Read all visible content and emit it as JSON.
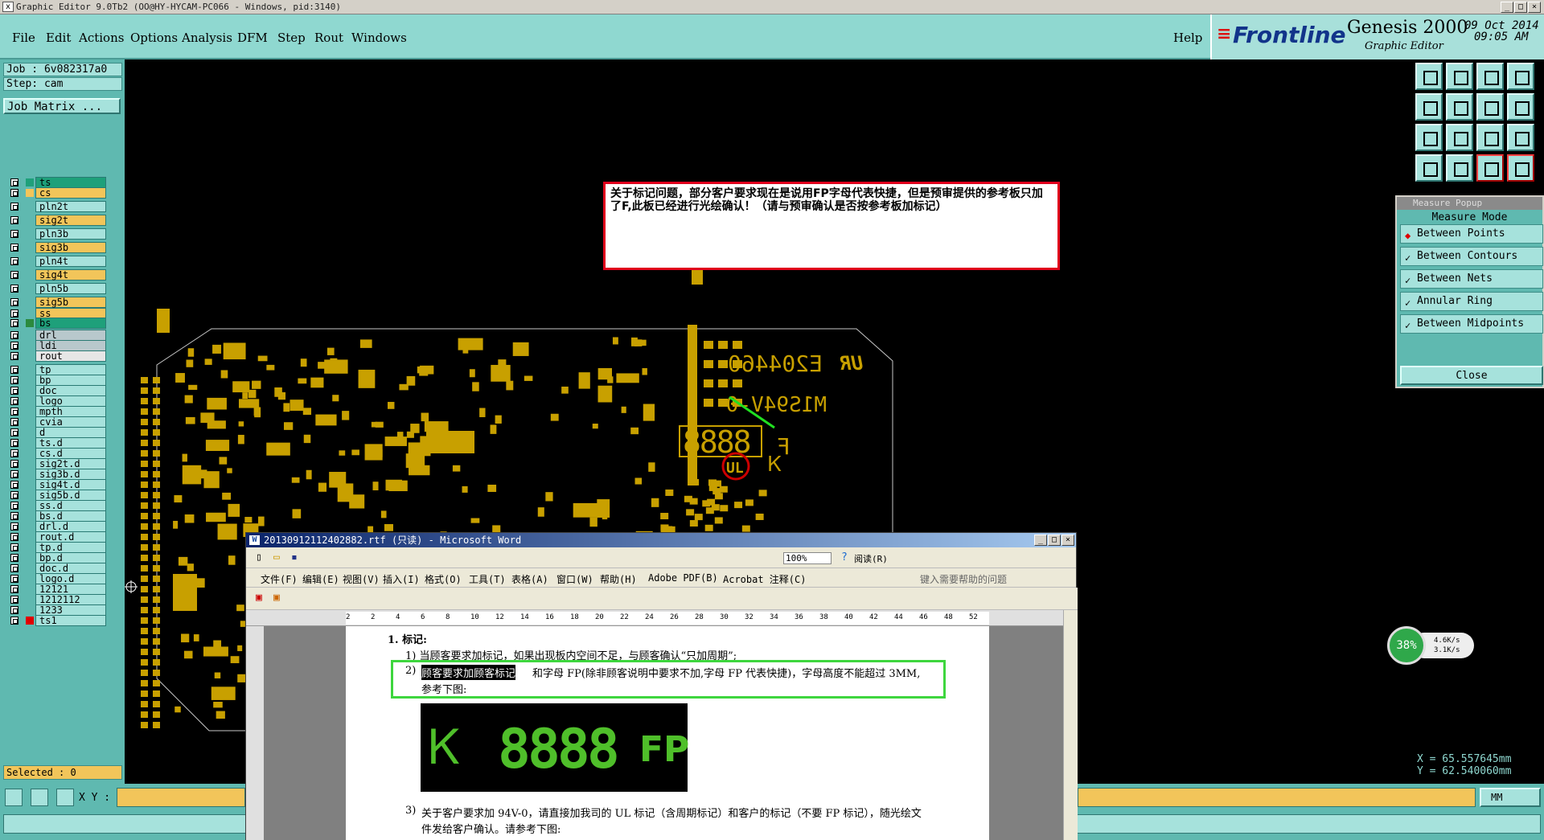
{
  "window": {
    "title": "Graphic Editor 9.0Tb2 (OO@HY-HYCAM-PC066 - Windows, pid:3140)",
    "min": "_",
    "max": "□",
    "close": "×"
  },
  "menu": [
    "File",
    "Edit",
    "Actions",
    "Options",
    "Analysis",
    "DFM",
    "Step",
    "Rout",
    "Windows"
  ],
  "help": "Help",
  "brand": {
    "logo": "Frontline",
    "product": "Genesis 2000",
    "sub": "Graphic Editor",
    "date": "09 Oct 2014",
    "time": "09:05 AM"
  },
  "job": {
    "job": "Job : 6v082317a0",
    "step": "Step: cam",
    "matrix": "Job Matrix ..."
  },
  "layers": [
    {
      "name": "ts",
      "color": "#1ea07a",
      "fill": "#1ea07a"
    },
    {
      "name": "cs",
      "color": "#f2c55a",
      "fill": "#f2c55a"
    },
    {
      "name": "pln2t",
      "color": "",
      "fill": "#a6e2dc"
    },
    {
      "name": "sig2t",
      "color": "",
      "fill": "#f2c55a"
    },
    {
      "name": "pln3b",
      "color": "",
      "fill": "#a6e2dc"
    },
    {
      "name": "sig3b",
      "color": "",
      "fill": "#f2c55a"
    },
    {
      "name": "pln4t",
      "color": "",
      "fill": "#a6e2dc"
    },
    {
      "name": "sig4t",
      "color": "",
      "fill": "#f2c55a"
    },
    {
      "name": "pln5b",
      "color": "",
      "fill": "#a6e2dc"
    },
    {
      "name": "sig5b",
      "color": "",
      "fill": "#f2c55a"
    },
    {
      "name": "ss",
      "color": "",
      "fill": "#f2c55a"
    },
    {
      "name": "bs",
      "color": "#2b8a3e",
      "fill": "#1ea07a"
    },
    {
      "name": "drl",
      "color": "",
      "fill": "#b8c8cc"
    },
    {
      "name": "ldi",
      "color": "",
      "fill": "#b8c8cc"
    },
    {
      "name": "rout",
      "color": "",
      "fill": "#e6e6e6"
    },
    {
      "name": "tp",
      "color": "",
      "fill": "#a6e2dc"
    },
    {
      "name": "bp",
      "color": "",
      "fill": "#a6e2dc"
    },
    {
      "name": "doc",
      "color": "",
      "fill": "#a6e2dc"
    },
    {
      "name": "logo",
      "color": "",
      "fill": "#a6e2dc"
    },
    {
      "name": "mpth",
      "color": "",
      "fill": "#a6e2dc"
    },
    {
      "name": "cvia",
      "color": "",
      "fill": "#a6e2dc"
    },
    {
      "name": "d",
      "color": "",
      "fill": "#a6e2dc"
    },
    {
      "name": "ts.d",
      "color": "",
      "fill": "#a6e2dc"
    },
    {
      "name": "cs.d",
      "color": "",
      "fill": "#a6e2dc"
    },
    {
      "name": "sig2t.d",
      "color": "",
      "fill": "#a6e2dc"
    },
    {
      "name": "sig3b.d",
      "color": "",
      "fill": "#a6e2dc"
    },
    {
      "name": "sig4t.d",
      "color": "",
      "fill": "#a6e2dc"
    },
    {
      "name": "sig5b.d",
      "color": "",
      "fill": "#a6e2dc"
    },
    {
      "name": "ss.d",
      "color": "",
      "fill": "#a6e2dc"
    },
    {
      "name": "bs.d",
      "color": "",
      "fill": "#a6e2dc"
    },
    {
      "name": "drl.d",
      "color": "",
      "fill": "#a6e2dc"
    },
    {
      "name": "rout.d",
      "color": "",
      "fill": "#a6e2dc"
    },
    {
      "name": "tp.d",
      "color": "",
      "fill": "#a6e2dc"
    },
    {
      "name": "bp.d",
      "color": "",
      "fill": "#a6e2dc"
    },
    {
      "name": "doc.d",
      "color": "",
      "fill": "#a6e2dc"
    },
    {
      "name": "logo.d",
      "color": "",
      "fill": "#a6e2dc"
    },
    {
      "name": "12121",
      "color": "",
      "fill": "#a6e2dc"
    },
    {
      "name": "1212112",
      "color": "",
      "fill": "#a6e2dc"
    },
    {
      "name": "1233",
      "color": "",
      "fill": "#a6e2dc"
    },
    {
      "name": "ts1",
      "color": "#e00000",
      "fill": "#a6e2dc"
    }
  ],
  "selected": "Selected : 0",
  "xy_label": "X Y :",
  "units": "MM",
  "measure": {
    "title": "Measure Popup",
    "heading": "Measure Mode",
    "options": [
      "Between Points",
      "Between Contours",
      "Between Nets",
      "Annular Ring",
      "Between Midpoints"
    ],
    "selected": 0,
    "close": "Close"
  },
  "coords": {
    "x": "X  =  65.557645mm",
    "y": "Y  =  62.540060mm"
  },
  "network": {
    "percent": "38%",
    "up": "4.6K/s",
    "down": "3.1K/s"
  },
  "note": "关于标记问题，部分客户要求现在是说用FP字母代表快捷，但是预审提供的参考板只加了F,此板已经进行光绘确认！（请与预审确认是否按参考板加标记）",
  "board": {
    "date_code": "E204460",
    "ul": "M1S94V-0",
    "digits": "8888",
    "f_label": "F",
    "ur_logo": "UR"
  },
  "word": {
    "title": "20130912112402882.rtf (只读) - Microsoft Word",
    "zoom": "100%",
    "read_label": "阅读(R)",
    "menu": [
      "文件(F)",
      "编辑(E)",
      "视图(V)",
      "插入(I)",
      "格式(O)",
      "工具(T)",
      "表格(A)",
      "窗口(W)",
      "帮助(H)",
      "Adobe PDF(B)",
      "Acrobat 注释(C)"
    ],
    "help_placeholder": "键入需要帮助的问题",
    "ruler": [
      "2",
      "2",
      "4",
      "6",
      "8",
      "10",
      "12",
      "14",
      "16",
      "18",
      "20",
      "22",
      "24",
      "26",
      "28",
      "30",
      "32",
      "34",
      "36",
      "38",
      "40",
      "42",
      "44",
      "46",
      "48",
      "52"
    ],
    "heading": "1.   标记:",
    "item1": "1)  当顾客要求加标记，如果出现板内空间不足，与顾客确认“只加周期”;",
    "item2_sel": "顾客要求加顾客标记",
    "item2_num": "2)",
    "item2_rest": "和字母 FP(除非顾客说明中要求不加,字母 FP 代表快捷)，字母高度不能超过 3MM,",
    "item2_b": "参考下图:",
    "img_digits": "8888",
    "img_fp": "FP",
    "item3_num": "3)",
    "item3": "关于客户要求加 94V-0，请直接加我司的 UL 标记（含周期标记）和客户的标记（不要 FP 标记），随光绘文",
    "item3_b": "件发给客户确认。请参考下图:"
  }
}
